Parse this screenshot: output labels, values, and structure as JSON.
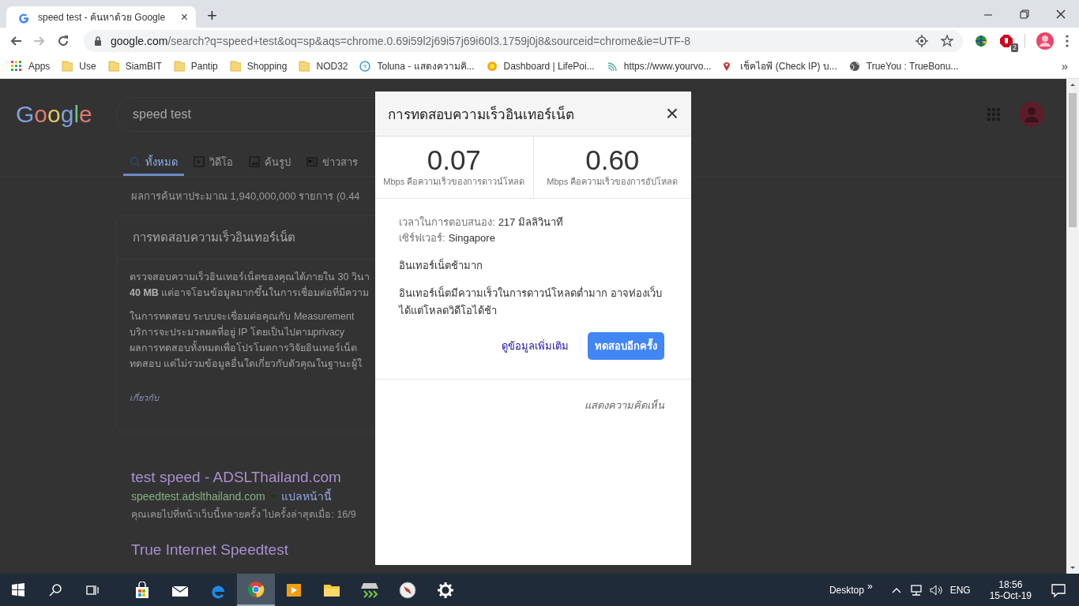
{
  "browser": {
    "tab": {
      "title": "speed test - ค้นหาด้วย Google",
      "close": "×"
    },
    "new_tab": "+",
    "address": {
      "host": "google.com",
      "path": "/search?q=speed+test&oq=sp&aqs=chrome.0.69i59l2j69i57j69i60l3.1759j0j8&sourceid=chrome&ie=UTF-8"
    },
    "extension_badge": "2",
    "bookmarks": [
      {
        "kind": "apps",
        "label": "Apps"
      },
      {
        "kind": "folder",
        "label": "Use"
      },
      {
        "kind": "folder",
        "label": "SiamBIT"
      },
      {
        "kind": "folder",
        "label": "Pantip"
      },
      {
        "kind": "folder",
        "label": "Shopping"
      },
      {
        "kind": "folder",
        "label": "NOD32"
      },
      {
        "kind": "site",
        "label": "Toluna - แสดงความคิ..."
      },
      {
        "kind": "sun",
        "label": "Dashboard | LifePoi..."
      },
      {
        "kind": "wave",
        "label": "https://www.yourvo..."
      },
      {
        "kind": "pin",
        "label": "เช็คไอพี (Check IP) บ..."
      },
      {
        "kind": "globe",
        "label": "TrueYou : TrueBonu..."
      }
    ],
    "bookmarks_more": "»"
  },
  "search_page": {
    "logo": "Google",
    "query": "speed test",
    "tabs": [
      {
        "label": "ทั้งหมด",
        "selected": true
      },
      {
        "label": "วิดีโอ",
        "selected": false
      },
      {
        "label": "ค้นรูป",
        "selected": false
      },
      {
        "label": "ข่าวสาร",
        "selected": false
      }
    ],
    "result_stats": "ผลการค้นหาประมาณ 1,940,000,000 รายการ (0.44",
    "card": {
      "title": "การทดสอบความเร็วอินเทอร์เน็ต",
      "paragraphs": [
        [
          "ตรวจสอบความเร็วอินเทอร์เน็ตของคุณได้ภายใน 30 วินา",
          "**40 MB** แต่อาจโอนข้อมูลมากขึ้นในการเชื่อมต่อที่มีความ"
        ],
        [
          "ในการทดสอบ ระบบจะเชื่อมต่อคุณกับ Measurement",
          "บริการจะประมวลผลที่อยู่ IP โดยเป็นไปตามprivacy",
          "ผลการทดสอบทั้งหมดเพื่อโปรโมตการวิจัยอินเทอร์เน็ต",
          "ทดสอบ แต่ไม่รวมข้อมูลอื่นใดเกี่ยวกับตัวคุณในฐานะผู้ใ"
        ]
      ],
      "about": "เกี่ยวกับ"
    },
    "results": [
      {
        "title": "test speed - ADSLThailand.com",
        "url": "speedtest.adslthailand.com",
        "translate": "แปลหน้านี้",
        "note": "คุณเคยไปที่หน้าเว็บนี้หลายครั้ง ไปครั้งล่าสุดเมื่อ: 16/9"
      },
      {
        "title": "True Internet Speedtest"
      }
    ]
  },
  "dialog": {
    "title": "การทดสอบความเร็วอินเทอร์เน็ต",
    "close": "×",
    "speeds": [
      {
        "value": "0.07",
        "label": "Mbps คือความเร็วของการดาวน์โหลด"
      },
      {
        "value": "0.60",
        "label": "Mbps คือความเร็วของการอัปโหลด"
      }
    ],
    "details": [
      {
        "label": "เวลาในการตอบสนอง:",
        "value": "217 มิลลิวินาที"
      },
      {
        "label": "เซิร์ฟเวอร์:",
        "value": "Singapore"
      }
    ],
    "verdict": "อินเทอร์เน็ตช้ามาก",
    "description": "อินเทอร์เน็ตมีความเร็วในการดาวน์โหลดต่ำมาก อาจท่องเว็บได้แต่โหลดวิดีโอได้ช้า",
    "more_link": "ดูข้อมูลเพิ่มเติม",
    "retest_button": "ทดสอบอีกครั้ง",
    "feedback": "แสดงความคิดเห็น"
  },
  "taskbar": {
    "apps": [
      {
        "active": false
      },
      {
        "active": false
      },
      {
        "active": false
      },
      {
        "active": true
      },
      {
        "active": false
      },
      {
        "active": false
      },
      {
        "active": false
      },
      {
        "active": false
      },
      {
        "active": false
      }
    ],
    "desktop": "Desktop",
    "desktop_more": "»",
    "language": "ENG",
    "time": "18:56",
    "date": "15-Oct-19"
  }
}
